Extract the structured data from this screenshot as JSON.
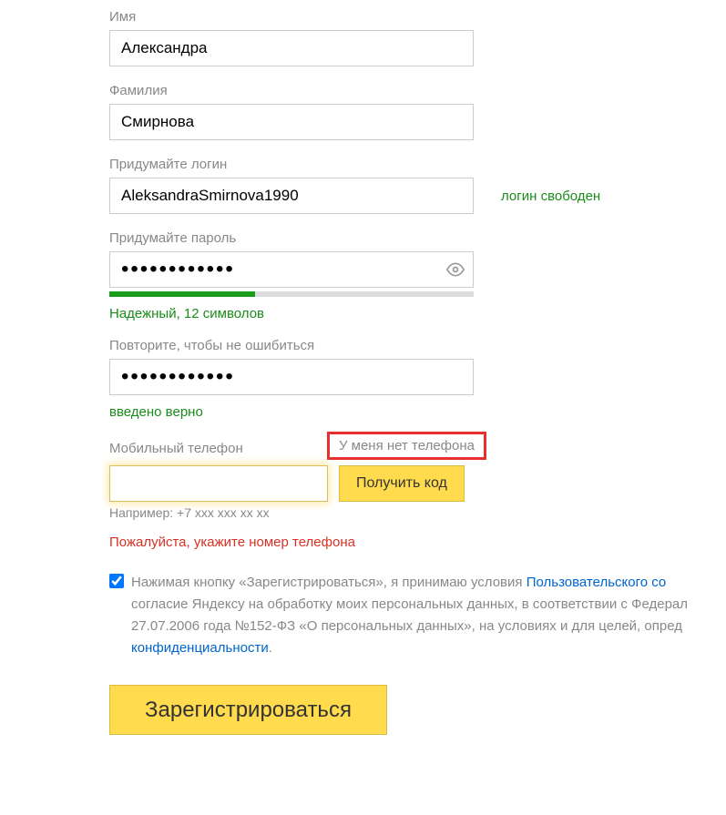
{
  "firstname": {
    "label": "Имя",
    "value": "Александра"
  },
  "lastname": {
    "label": "Фамилия",
    "value": "Смирнова"
  },
  "login": {
    "label": "Придумайте логин",
    "value": "AleksandraSmirnova1990",
    "status": "логин свободен"
  },
  "password": {
    "label": "Придумайте пароль",
    "value": "••••••••••••",
    "strength_text": "Надежный, 12 символов"
  },
  "password_confirm": {
    "label": "Повторите, чтобы не ошибиться",
    "value": "••••••••••••",
    "status": "введено верно"
  },
  "phone": {
    "label": "Мобильный телефон",
    "no_phone_link": "У меня нет телефона",
    "value": "",
    "get_code_btn": "Получить код",
    "hint": "Например: +7 xxx xxx xx xx",
    "error": "Пожалуйста, укажите номер телефона"
  },
  "agreement": {
    "line1_prefix": "Нажимая кнопку «Зарегистрироваться», я принимаю условия ",
    "line1_link": "Пользовательского со",
    "line2": "согласие Яндексу на обработку моих персональных данных, в соответствии с Федерал",
    "line3": "27.07.2006 года №152-ФЗ «О персональных данных», на условиях и для целей, опред",
    "line4_link": "конфиденциальности",
    "line4_suffix": "."
  },
  "register_btn": "Зарегистрироваться"
}
